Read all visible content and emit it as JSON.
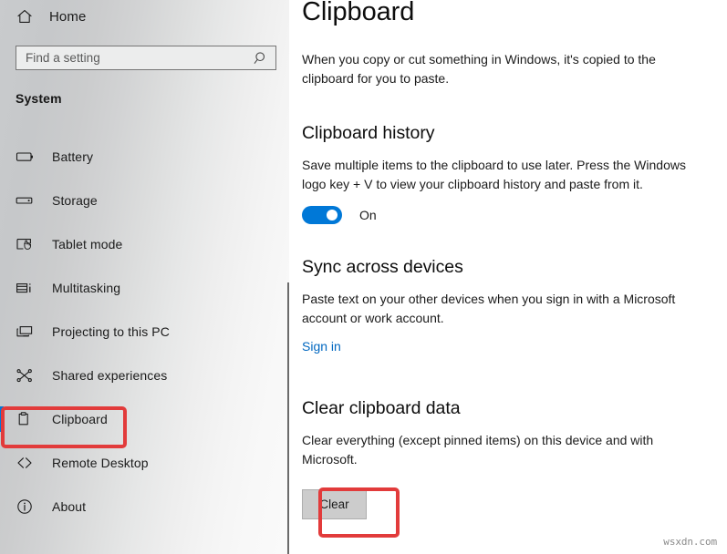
{
  "sidebar": {
    "home": {
      "label": "Home",
      "icon": "home-icon"
    },
    "search": {
      "placeholder": "Find a setting",
      "icon": "search-icon"
    },
    "section_title": "System",
    "items": [
      {
        "label": "Battery",
        "icon": "battery-icon",
        "selected": false
      },
      {
        "label": "Storage",
        "icon": "storage-icon",
        "selected": false
      },
      {
        "label": "Tablet mode",
        "icon": "tablet-mode-icon",
        "selected": false
      },
      {
        "label": "Multitasking",
        "icon": "multitasking-icon",
        "selected": false
      },
      {
        "label": "Projecting to this PC",
        "icon": "projecting-icon",
        "selected": false
      },
      {
        "label": "Shared experiences",
        "icon": "shared-experiences-icon",
        "selected": false
      },
      {
        "label": "Clipboard",
        "icon": "clipboard-icon",
        "selected": true
      },
      {
        "label": "Remote Desktop",
        "icon": "remote-desktop-icon",
        "selected": false
      },
      {
        "label": "About",
        "icon": "info-icon",
        "selected": false
      }
    ]
  },
  "main": {
    "title": "Clipboard",
    "intro": "When you copy or cut something in Windows, it's copied to the clipboard for you to paste.",
    "history": {
      "title": "Clipboard history",
      "description": "Save multiple items to the clipboard to use later. Press the Windows logo key + V to view your clipboard history and paste from it.",
      "toggle_state": "On"
    },
    "sync": {
      "title": "Sync across devices",
      "description": "Paste text on your other devices when you sign in with a Microsoft account or work account.",
      "link_label": "Sign in"
    },
    "clear": {
      "title": "Clear clipboard data",
      "description": "Clear everything (except pinned items) on this device and with Microsoft.",
      "button_label": "Clear"
    }
  },
  "annotations": {
    "color": "#e23b3b",
    "targets": [
      "sidebar-item-clipboard",
      "clear-button"
    ]
  },
  "watermark": "wsxdn.com",
  "colors": {
    "accent": "#0078d7",
    "link": "#0067c0",
    "annotation": "#e23b3b",
    "button_face": "#cccccc"
  }
}
